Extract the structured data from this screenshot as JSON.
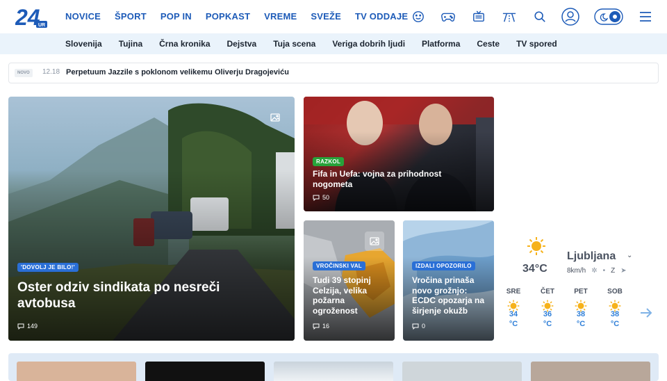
{
  "logo": {
    "text": "24",
    "sub": "UR"
  },
  "nav": [
    "NOVICE",
    "ŠPORT",
    "POP IN",
    "POPKAST",
    "VREME",
    "SVEŽE",
    "TV ODDAJE"
  ],
  "nav_more": "·",
  "header_icons": [
    "smiley-icon",
    "gamepad-icon",
    "tv-icon",
    "road-icon",
    "search-icon",
    "user-icon",
    "theme-toggle-icon",
    "menu-icon"
  ],
  "subnav": [
    "Slovenija",
    "Tujina",
    "Črna kronika",
    "Dejstva",
    "Tuja scena",
    "Veriga dobrih ljudi",
    "Platforma",
    "Ceste",
    "TV spored"
  ],
  "ticker": {
    "badge": "NOVO",
    "time": "12.18",
    "headline": "Perpetuum Jazzile s poklonom velikemu Oliverju Dragojeviću"
  },
  "colors": {
    "brand": "#1d5bb8",
    "tag_blue": "#2a6fd6",
    "tag_green": "#27a23a",
    "weather_blue": "#2f7fd8"
  },
  "articles": {
    "main": {
      "tag": "'DOVOLJ JE BILO!'",
      "title": "Oster odziv sindikata po nesreči avtobusa",
      "comments": "149"
    },
    "fifa": {
      "tag": "RAZKOL",
      "title": "Fifa in Uefa: vojna za prihodnost nogometa",
      "comments": "50"
    },
    "heat": {
      "tag": "VROČINSKI VAL",
      "title": "Tudi 39 stopinj Celzija, velika požarna ogroženost",
      "comments": "16"
    },
    "ecdc": {
      "tag": "IZDALI OPOZORILO",
      "title": "Vročina prinaša novo grožnjo: ECDC opozarja na širjenje okužb",
      "comments": "0"
    }
  },
  "weather": {
    "city": "Ljubljana",
    "temp": "34°C",
    "wind": "8km/h",
    "wind_dir": "Z",
    "days": [
      {
        "day": "SRE",
        "temp": "34",
        "unit": "°C"
      },
      {
        "day": "ČET",
        "temp": "36",
        "unit": "°C"
      },
      {
        "day": "PET",
        "temp": "38",
        "unit": "°C"
      },
      {
        "day": "SOB",
        "temp": "38",
        "unit": "°C"
      }
    ]
  }
}
